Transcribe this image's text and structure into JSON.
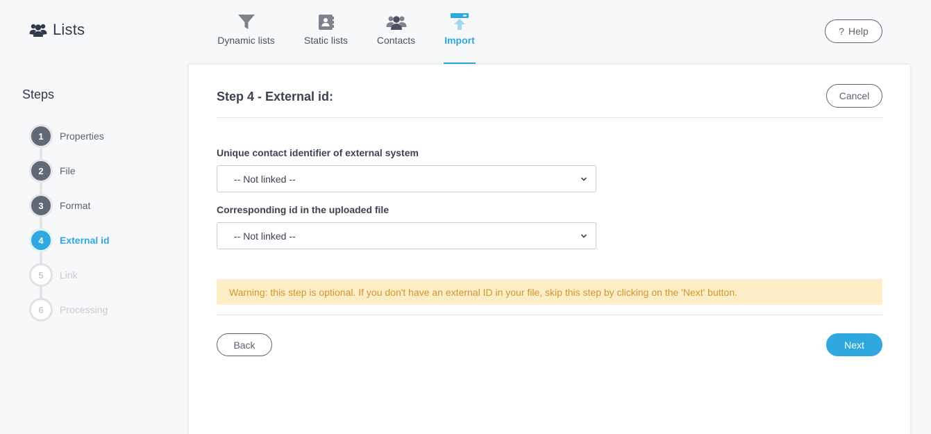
{
  "app": {
    "title": "Lists",
    "icon": "users-icon"
  },
  "nav": {
    "tabs": [
      {
        "label": "Dynamic lists",
        "icon": "filter-icon",
        "active": false
      },
      {
        "label": "Static lists",
        "icon": "contact-book-icon",
        "active": false
      },
      {
        "label": "Contacts",
        "icon": "users-icon",
        "active": false
      },
      {
        "label": "Import",
        "icon": "upload-icon",
        "active": true
      }
    ]
  },
  "help": {
    "label": "Help",
    "icon": "question-icon"
  },
  "steps": {
    "title": "Steps",
    "items": [
      {
        "number": "1",
        "label": "Properties",
        "state": "done"
      },
      {
        "number": "2",
        "label": "File",
        "state": "done"
      },
      {
        "number": "3",
        "label": "Format",
        "state": "done"
      },
      {
        "number": "4",
        "label": "External id",
        "state": "current"
      },
      {
        "number": "5",
        "label": "Link",
        "state": "pending"
      },
      {
        "number": "6",
        "label": "Processing",
        "state": "pending"
      }
    ]
  },
  "main": {
    "title": "Step 4 - External id:",
    "cancel_label": "Cancel",
    "fields": [
      {
        "label": "Unique contact identifier of external system",
        "value": "-- Not linked --"
      },
      {
        "label": "Corresponding id in the uploaded file",
        "value": "-- Not linked --"
      }
    ],
    "warning": "Warning: this step is optional. If you don't have an external ID in your file, skip this step by clicking on the 'Next' button.",
    "back_label": "Back",
    "next_label": "Next"
  },
  "colors": {
    "accent": "#2ea8df",
    "warning_bg": "#fbedc6",
    "warning_text": "#d4952c",
    "step_done": "#616975"
  }
}
